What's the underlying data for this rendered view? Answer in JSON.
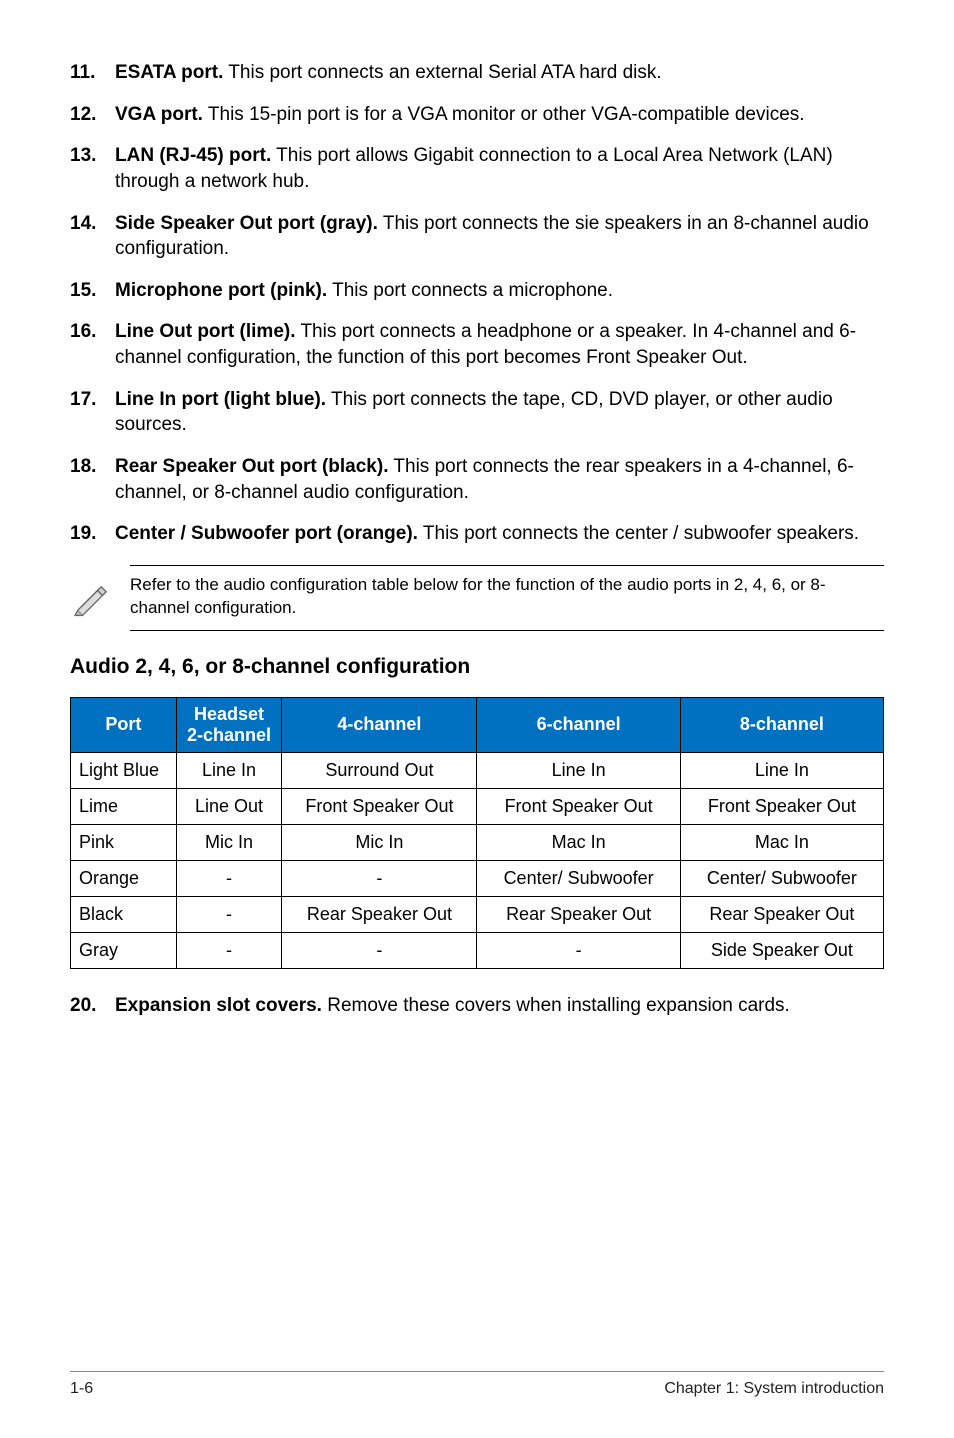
{
  "items": [
    {
      "num": "11.",
      "lead": "ESATA port.",
      "text": "This port connects an external Serial ATA hard disk."
    },
    {
      "num": "12.",
      "lead": "VGA port.",
      "text": "This 15-pin port is for a VGA monitor or other VGA-compatible devices."
    },
    {
      "num": "13.",
      "lead": "LAN (RJ-45) port.",
      "text": "This port allows Gigabit connection to a Local Area Network (LAN) through a network hub."
    },
    {
      "num": "14.",
      "lead": "Side Speaker Out port (gray).",
      "text": "This port connects the sie speakers in an 8-channel audio configuration."
    },
    {
      "num": "15.",
      "lead": "Microphone port (pink).",
      "text": "This port connects a microphone."
    },
    {
      "num": "16.",
      "lead": "Line Out port (lime).",
      "text": "This port connects a headphone or a speaker. In 4-channel and 6-channel configuration, the function of this port becomes Front Speaker Out."
    },
    {
      "num": "17.",
      "lead": "Line In port (light blue).",
      "text": "This port connects the tape, CD, DVD player, or other audio sources."
    },
    {
      "num": "18.",
      "lead": "Rear Speaker Out port (black).",
      "text": "This port connects the rear speakers in a 4-channel, 6-channel, or 8-channel audio configuration."
    },
    {
      "num": "19.",
      "lead": "Center / Subwoofer port (orange).",
      "text": "This port connects the center / subwoofer speakers."
    }
  ],
  "note": "Refer to the audio configuration table below for the function of the audio ports in 2, 4, 6, or 8-channel configuration.",
  "section_title": "Audio 2, 4, 6, or 8-channel configuration",
  "table": {
    "headers": {
      "port": "Port",
      "h2a": "Headset",
      "h2b": "2-channel",
      "h4": "4-channel",
      "h6": "6-channel",
      "h8": "8-channel"
    },
    "rows": [
      {
        "port": "Light Blue",
        "c2": "Line In",
        "c4": "Surround Out",
        "c6": "Line In",
        "c8": "Line In"
      },
      {
        "port": "Lime",
        "c2": "Line Out",
        "c4": "Front Speaker Out",
        "c6": "Front Speaker Out",
        "c8": "Front Speaker Out"
      },
      {
        "port": "Pink",
        "c2": "Mic In",
        "c4": "Mic In",
        "c6": "Mac In",
        "c8": "Mac In"
      },
      {
        "port": "Orange",
        "c2": "-",
        "c4": "-",
        "c6": "Center/ Subwoofer",
        "c8": "Center/ Subwoofer"
      },
      {
        "port": "Black",
        "c2": "-",
        "c4": "Rear Speaker Out",
        "c6": "Rear Speaker Out",
        "c8": "Rear Speaker Out"
      },
      {
        "port": "Gray",
        "c2": "-",
        "c4": "-",
        "c6": "-",
        "c8": "Side Speaker Out"
      }
    ]
  },
  "item20": {
    "num": "20.",
    "lead": "Expansion slot covers.",
    "text": "Remove these covers when installing expansion cards."
  },
  "footer": {
    "left": "1-6",
    "right": "Chapter 1: System introduction"
  }
}
